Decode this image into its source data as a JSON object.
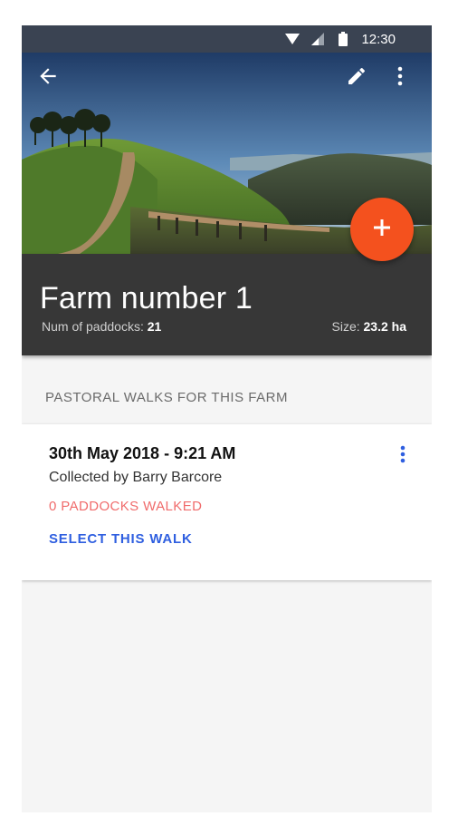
{
  "status_bar": {
    "time": "12:30"
  },
  "header": {
    "icons": {
      "back": "arrow-left-icon",
      "edit": "pencil-icon",
      "more": "more-vert-icon"
    }
  },
  "farm": {
    "title": "Farm number 1",
    "paddocks_label": "Num of paddocks:",
    "paddocks_value": "21",
    "size_label": "Size:",
    "size_value": "23.2 ha"
  },
  "fab": {
    "icon": "plus-icon",
    "color": "#f4511e"
  },
  "section": {
    "title": "PASTORAL WALKS FOR THIS FARM"
  },
  "walks": [
    {
      "date": "30th May 2018 - 9:21 AM",
      "collected_by": "Collected by Barry Barcore",
      "paddocks_walked": "0 PADDOCKS WALKED",
      "action": "SELECT THIS WALK"
    }
  ],
  "colors": {
    "accent_blue": "#2f5fe0",
    "warning_red": "#f06b6b",
    "panel_dark": "#373737"
  }
}
